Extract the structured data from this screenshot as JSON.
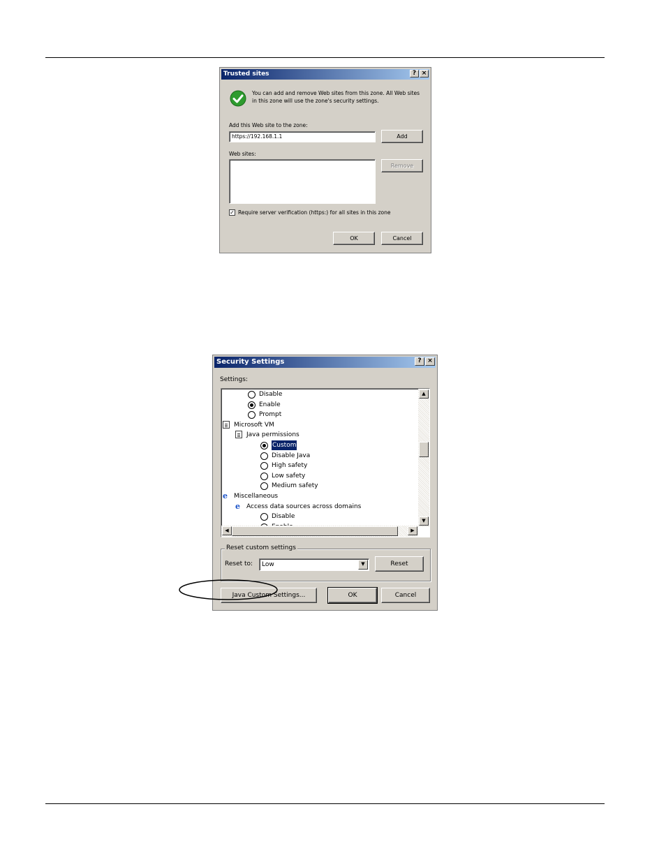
{
  "trusted_sites": {
    "title": "Trusted sites",
    "help_btn": "?",
    "close_btn": "×",
    "info_text_line1": "You can add and remove Web sites from this zone. All Web sites",
    "info_text_line2": "in this zone will use the zone's security settings.",
    "add_label": "Add this Web site to the zone:",
    "add_value": "https://192.168.1.1",
    "add_button": "Add",
    "websites_label": "Web sites:",
    "remove_button": "Remove",
    "require_checkbox_checked": true,
    "require_checkbox_mark": "✓",
    "require_label": "Require server verification (https:) for all sites in this zone",
    "ok_button": "OK",
    "cancel_button": "Cancel"
  },
  "security_settings": {
    "title": "Security Settings",
    "help_btn": "?",
    "close_btn": "×",
    "settings_label": "Settings:",
    "tree": [
      {
        "type": "radio",
        "label": "Disable",
        "checked": false,
        "indent": 1
      },
      {
        "type": "radio",
        "label": "Enable",
        "checked": true,
        "indent": 1
      },
      {
        "type": "radio",
        "label": "Prompt",
        "checked": false,
        "indent": 1
      },
      {
        "type": "doc",
        "label": "Microsoft VM",
        "indent": 0
      },
      {
        "type": "doc",
        "label": "Java permissions",
        "indent": 1
      },
      {
        "type": "radio",
        "label": "Custom",
        "checked": true,
        "selected": true,
        "indent": 2
      },
      {
        "type": "radio",
        "label": "Disable Java",
        "checked": false,
        "indent": 2
      },
      {
        "type": "radio",
        "label": "High safety",
        "checked": false,
        "indent": 2
      },
      {
        "type": "radio",
        "label": "Low safety",
        "checked": false,
        "indent": 2
      },
      {
        "type": "radio",
        "label": "Medium safety",
        "checked": false,
        "indent": 2
      },
      {
        "type": "ie",
        "label": "Miscellaneous",
        "indent": 0
      },
      {
        "type": "ie",
        "label": "Access data sources across domains",
        "indent": 1
      },
      {
        "type": "radio",
        "label": "Disable",
        "checked": false,
        "indent": 2
      },
      {
        "type": "radio",
        "label": "Enable",
        "checked": true,
        "indent": 2
      }
    ],
    "scroll_up": "▲",
    "scroll_down": "▼",
    "scroll_left": "◀",
    "scroll_right": "▶",
    "reset_group_label": "Reset custom settings",
    "reset_to_label": "Reset to:",
    "reset_to_value": "Low",
    "dropdown_arrow": "▼",
    "reset_button": "Reset",
    "java_custom_button": "Java Custom Settings...",
    "ok_button": "OK",
    "cancel_button": "Cancel"
  },
  "icons": {
    "info": "green-check-icon",
    "doc": "document-settings-icon",
    "ie": "internet-explorer-icon",
    "ie_glyph": "e"
  },
  "colors": {
    "titlebar_start": "#0a246a",
    "titlebar_end": "#a6caf0",
    "dialog_bg": "#d4d0c8",
    "check_green": "#2e9b2e",
    "selection": "#0a246a"
  }
}
